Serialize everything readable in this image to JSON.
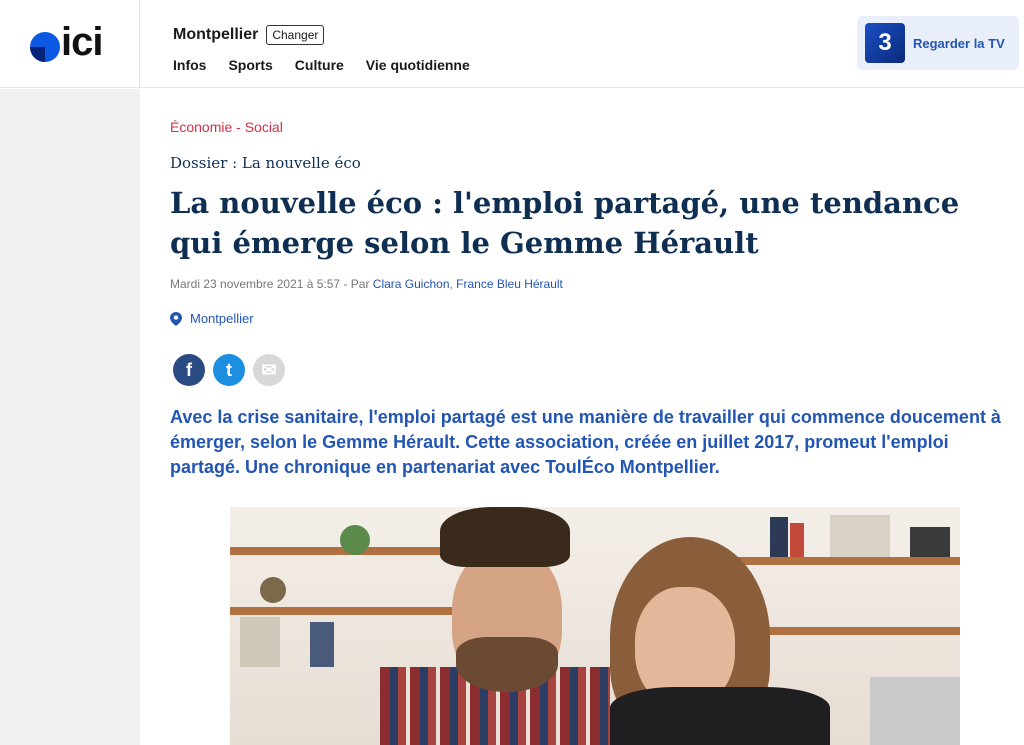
{
  "header": {
    "logo_text": "ici",
    "region_name": "Montpellier",
    "change_label": "Changer",
    "nav": [
      "Infos",
      "Sports",
      "Culture",
      "Vie quotidienne"
    ],
    "tv_badge": "3",
    "tv_label": "Regarder la TV"
  },
  "article": {
    "kicker": "Économie - Social",
    "dossier": "Dossier : La nouvelle éco",
    "title": "La nouvelle éco : l'emploi partagé, une tendance qui émerge selon le Gemme Hérault",
    "meta_prefix": "Mardi 23 novembre 2021 à 5:57 - Par ",
    "author": "Clara Guichon",
    "separator": ", ",
    "outlet": "France Bleu Hérault",
    "location": "Montpellier",
    "lead": "Avec la crise sanitaire, l'emploi partagé est une manière de travailler qui commence doucement à émerger, selon le Gemme Hérault. Cette association, créée en juillet 2017, promeut l'emploi partagé. Une chronique en partenariat avec ToulÉco Montpellier."
  },
  "share": {
    "facebook_glyph": "f",
    "twitter_glyph": "t",
    "mail_glyph": "✉"
  },
  "colors": {
    "kicker": "#d63045",
    "title": "#0f2f52",
    "link": "#2356b4",
    "facebook": "#2a4a82",
    "twitter": "#1d8fe0"
  },
  "icons": {
    "logo": "ici-logo",
    "location": "pin-icon",
    "facebook": "facebook-icon",
    "twitter": "twitter-icon",
    "mail": "mail-icon"
  }
}
